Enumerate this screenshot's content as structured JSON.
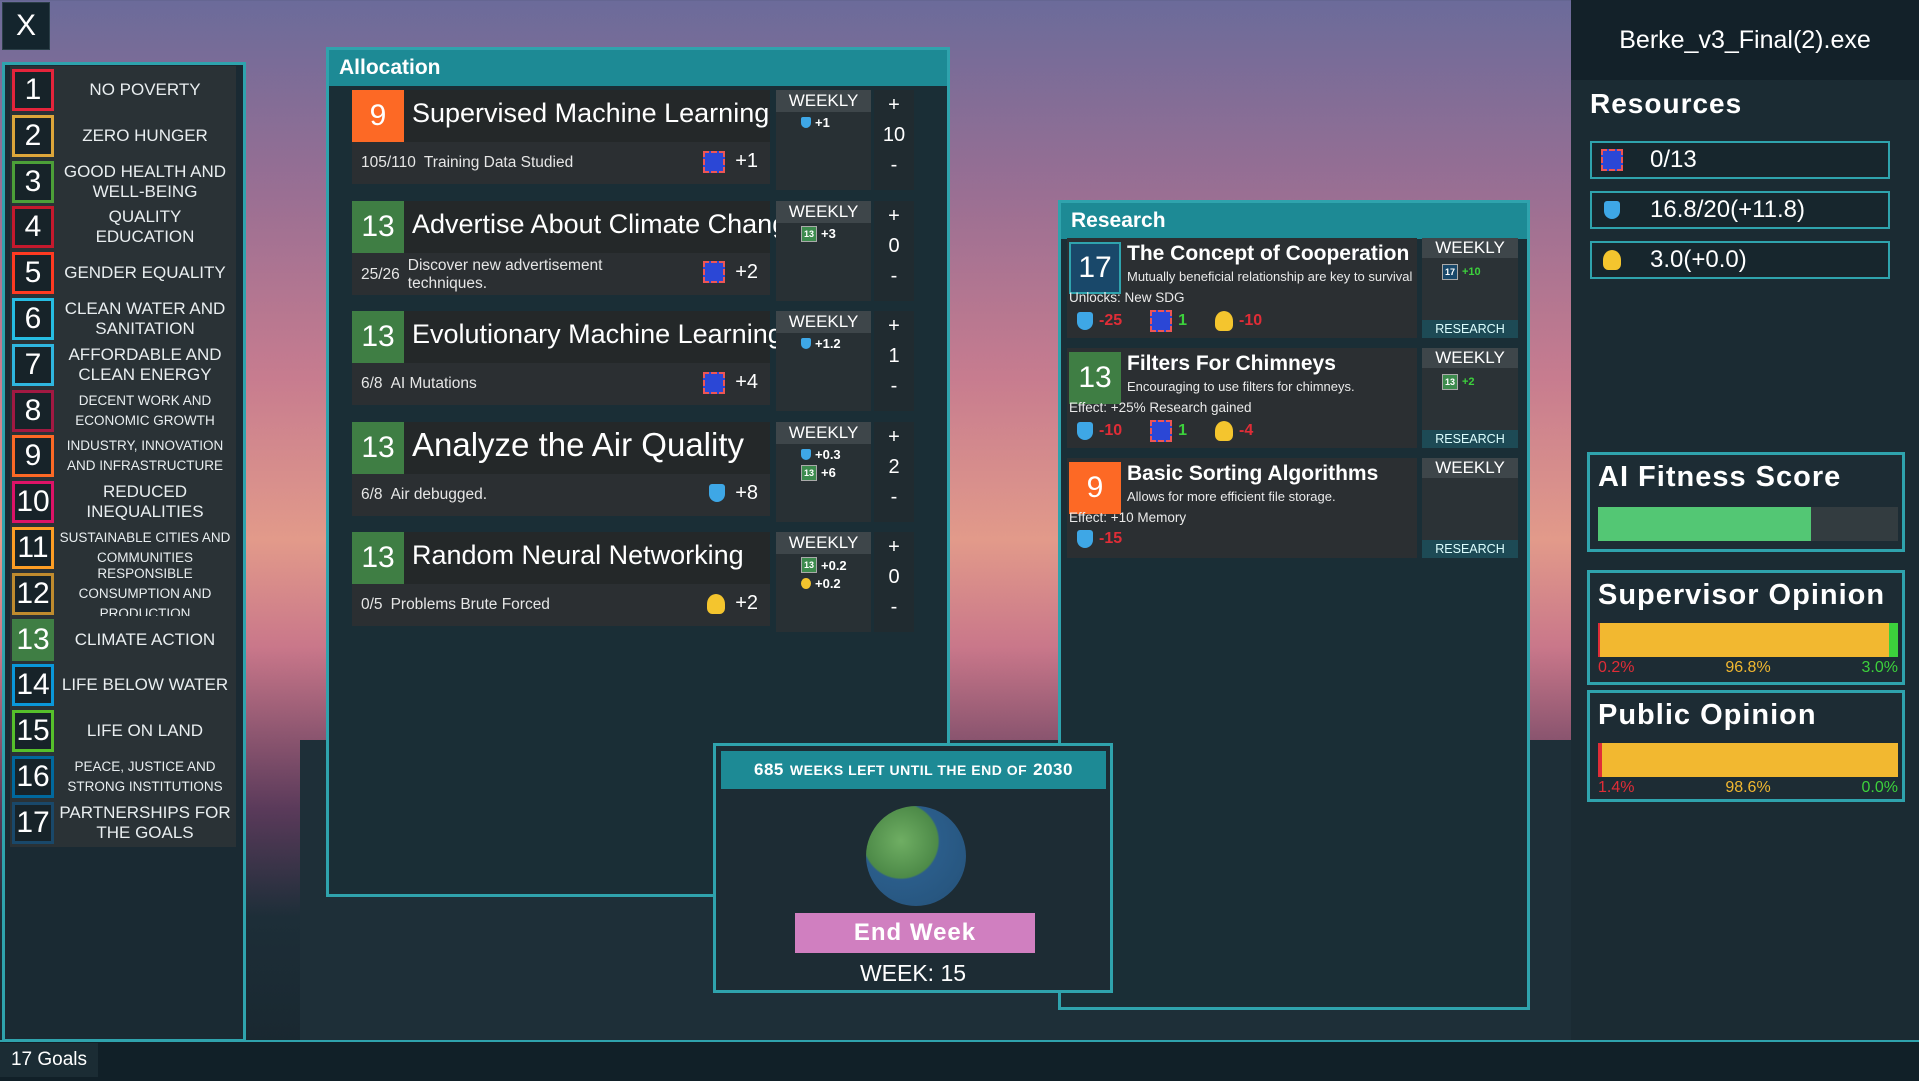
{
  "window_title": "Berke_v3_Final(2).exe",
  "close_label": "X",
  "goals_tab": "17 Goals",
  "sdgs": [
    {
      "n": "1",
      "label": "NO POVERTY",
      "color": "#e5243b"
    },
    {
      "n": "2",
      "label": "ZERO HUNGER",
      "color": "#dda63a"
    },
    {
      "n": "3",
      "label": "GOOD HEALTH AND WELL-BEING",
      "color": "#4c9f38"
    },
    {
      "n": "4",
      "label": "QUALITY EDUCATION",
      "color": "#c5192d"
    },
    {
      "n": "5",
      "label": "GENDER EQUALITY",
      "color": "#ff3a21"
    },
    {
      "n": "6",
      "label": "CLEAN WATER AND SANITATION",
      "color": "#26bde2"
    },
    {
      "n": "7",
      "label": "AFFORDABLE AND CLEAN ENERGY",
      "color": "#2fb6df"
    },
    {
      "n": "8",
      "label": "DECENT WORK AND ECONOMIC GROWTH",
      "color": "#a21942"
    },
    {
      "n": "9",
      "label": "INDUSTRY, INNOVATION AND INFRASTRUCTURE",
      "color": "#fd6925"
    },
    {
      "n": "10",
      "label": "REDUCED INEQUALITIES",
      "color": "#dd1367"
    },
    {
      "n": "11",
      "label": "SUSTAINABLE CITIES AND COMMUNITIES",
      "color": "#fd9d24"
    },
    {
      "n": "12",
      "label": "RESPONSIBLE CONSUMPTION AND PRODUCTION",
      "color": "#bf8b2e"
    },
    {
      "n": "13",
      "label": "CLIMATE ACTION",
      "color": "#3f7e44"
    },
    {
      "n": "14",
      "label": "LIFE BELOW WATER",
      "color": "#0a97d9"
    },
    {
      "n": "15",
      "label": "LIFE ON LAND",
      "color": "#56c02b"
    },
    {
      "n": "16",
      "label": "PEACE, JUSTICE AND STRONG INSTITUTIONS",
      "color": "#00689d"
    },
    {
      "n": "17",
      "label": "PARTNERSHIPS FOR THE GOALS",
      "color": "#19486a"
    }
  ],
  "allocation": {
    "title": "Allocation",
    "weekly_label": "WEEKLY",
    "plus": "+",
    "minus": "-",
    "items": [
      {
        "sdg": "9",
        "sdg_color": "#fd6925",
        "title": "Supervised Machine Learning",
        "progress": "105/110",
        "desc": "Training Data Studied",
        "bonus": "+1",
        "bonus_icon": "chip-icon",
        "weekly": [
          {
            "icon": "flask-icon",
            "val": "+1"
          }
        ],
        "count": "10"
      },
      {
        "sdg": "13",
        "sdg_color": "#3f7e44",
        "title": "Advertise About Climate Change",
        "progress": "25/26",
        "desc": "Discover new advertisement techniques.",
        "bonus": "+2",
        "bonus_icon": "chip-icon",
        "weekly": [
          {
            "icon": "sdg13-icon",
            "val": "+3"
          }
        ],
        "count": "0"
      },
      {
        "sdg": "13",
        "sdg_color": "#3f7e44",
        "title": "Evolutionary Machine Learning",
        "progress": "6/8",
        "desc": "AI Mutations",
        "bonus": "+4",
        "bonus_icon": "chip-icon",
        "weekly": [
          {
            "icon": "flask-icon",
            "val": "+1.2"
          }
        ],
        "count": "1"
      },
      {
        "sdg": "13",
        "sdg_color": "#3f7e44",
        "title": "Analyze the Air Quality",
        "progress": "6/8",
        "desc": "Air debugged.",
        "bonus": "+8",
        "bonus_icon": "flask-icon",
        "weekly": [
          {
            "icon": "flask-icon",
            "val": "+0.3"
          },
          {
            "icon": "sdg13-icon",
            "val": "+6"
          }
        ],
        "count": "2"
      },
      {
        "sdg": "13",
        "sdg_color": "#3f7e44",
        "title": "Random Neural Networking",
        "progress": "0/5",
        "desc": "Problems Brute Forced",
        "bonus": "+2",
        "bonus_icon": "bulb-icon",
        "weekly": [
          {
            "icon": "sdg13-icon",
            "val": "+0.2"
          },
          {
            "icon": "bulb-icon",
            "val": "+0.2"
          }
        ],
        "count": "0"
      }
    ]
  },
  "research": {
    "title": "Research",
    "weekly_label": "WEEKLY",
    "button_label": "RESEARCH",
    "items": [
      {
        "sdg": "17",
        "sdg_color": "#19486a",
        "title": "The Concept of Cooperation",
        "subtitle": "Mutually beneficial relationship are key to survival",
        "effect": "Unlocks: New SDG",
        "costs": [
          {
            "icon": "flask-icon",
            "val": "-25",
            "cls": "red"
          },
          {
            "icon": "chip-icon",
            "val": "1",
            "cls": "green"
          },
          {
            "icon": "bulb-icon",
            "val": "-10",
            "cls": "red"
          }
        ],
        "weekly": {
          "icon": "sdg17-icon",
          "badge": "17",
          "val": "+10"
        }
      },
      {
        "sdg": "13",
        "sdg_color": "#3f7e44",
        "title": "Filters For Chimneys",
        "subtitle": "Encouraging to use filters for chimneys.",
        "effect": "Effect: +25% Research gained",
        "costs": [
          {
            "icon": "flask-icon",
            "val": "-10",
            "cls": "red"
          },
          {
            "icon": "chip-icon",
            "val": "1",
            "cls": "green"
          },
          {
            "icon": "bulb-icon",
            "val": "-4",
            "cls": "red"
          }
        ],
        "weekly": {
          "icon": "sdg13-icon",
          "badge": "13",
          "val": "+2"
        }
      },
      {
        "sdg": "9",
        "sdg_color": "#fd6925",
        "title": "Basic Sorting Algorithms",
        "subtitle": "Allows for more efficient file storage.",
        "effect": "Effect: +10 Memory",
        "costs": [
          {
            "icon": "flask-icon",
            "val": "-15",
            "cls": "red"
          }
        ],
        "weekly": null
      }
    ]
  },
  "resources": {
    "title": "Resources",
    "items": [
      {
        "icon": "chip-icon",
        "val": "0/13"
      },
      {
        "icon": "flask-icon",
        "val": "16.8/20(+11.8)"
      },
      {
        "icon": "bulb-icon",
        "val": "3.0(+0.0)"
      }
    ]
  },
  "fitness": {
    "title": "AI Fitness Score",
    "fill": 0.71,
    "color": "#53c774"
  },
  "supervisor": {
    "title": "Supervisor Opinion",
    "neg": "0.2%",
    "neu": "96.8%",
    "pos": "3.0%",
    "neg_frac": 0.002,
    "neu_frac": 0.968,
    "pos_frac": 0.03
  },
  "public": {
    "title": "Public Opinion",
    "neg": "1.4%",
    "neu": "98.6%",
    "pos": "0.0%",
    "neg_frac": 0.014,
    "neu_frac": 0.986,
    "pos_frac": 0.0
  },
  "weeks": {
    "count": "685",
    "text": "WEEKS LEFT UNTIL THE END OF",
    "year": "2030",
    "end_week": "End Week",
    "week_label": "WEEK: 15"
  },
  "colors": {
    "accent": "#2fa3ad",
    "header": "#1d8a95",
    "negative": "#e02d37",
    "positive": "#3cd13c",
    "neutral": "#f2b830"
  }
}
